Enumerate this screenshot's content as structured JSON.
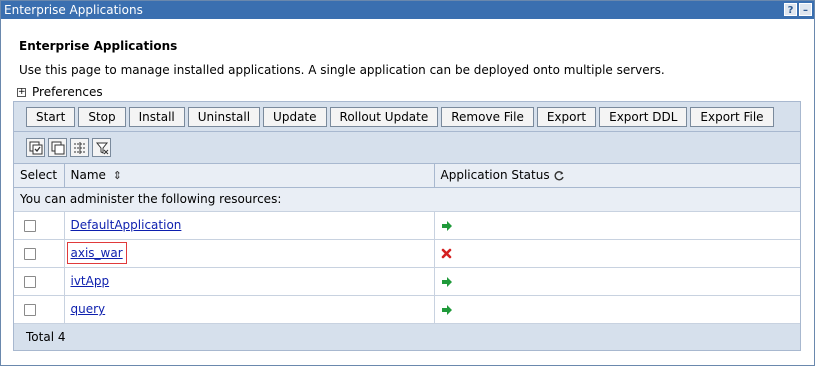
{
  "window": {
    "title": "Enterprise Applications",
    "help_label": "?",
    "minimize_label": "–"
  },
  "page": {
    "title": "Enterprise Applications",
    "description": "Use this page to manage installed applications. A single application can be deployed onto multiple servers.",
    "preferences_label": "Preferences"
  },
  "toolbar": {
    "buttons": [
      "Start",
      "Stop",
      "Install",
      "Uninstall",
      "Update",
      "Rollout Update",
      "Remove File",
      "Export",
      "Export DDL",
      "Export File"
    ]
  },
  "icon_toolbar": {
    "icons": [
      "select-all-icon",
      "deselect-all-icon",
      "show-filter-icon",
      "clear-filter-icon"
    ]
  },
  "table": {
    "headers": {
      "select": "Select",
      "name": "Name",
      "status": "Application Status"
    },
    "admin_message": "You can administer the following resources:",
    "rows": [
      {
        "name": "DefaultApplication",
        "status": "started",
        "checked": false
      },
      {
        "name": "axis_war",
        "status": "stopped",
        "checked": false,
        "highlighted": true
      },
      {
        "name": "ivtApp",
        "status": "started",
        "checked": false
      },
      {
        "name": "query",
        "status": "started",
        "checked": false
      }
    ],
    "total": "Total 4"
  },
  "colors": {
    "started": "#1f9a3a",
    "stopped": "#d42020",
    "titlebar": "#3a6fb0",
    "link": "#0d1fae"
  }
}
